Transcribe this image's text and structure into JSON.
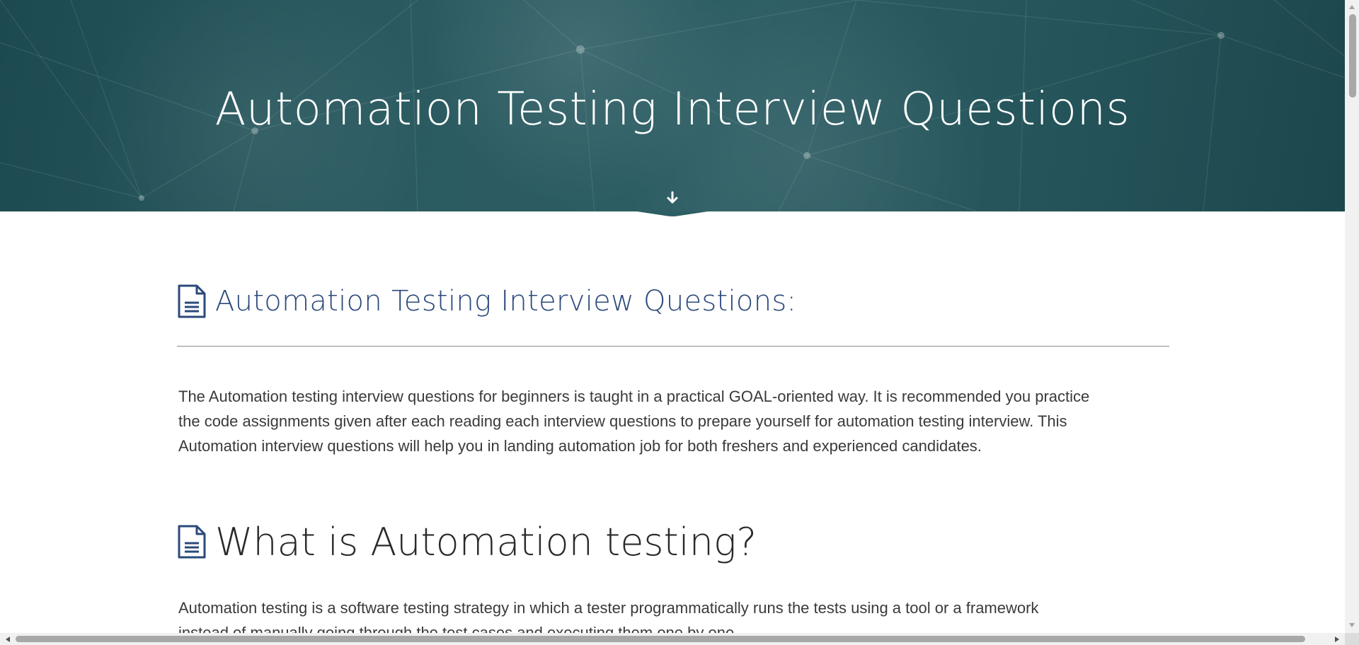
{
  "hero": {
    "title": "Automation Testing Interview Questions"
  },
  "section_intro": {
    "heading": "Automation Testing Interview Questions:",
    "paragraph_lines": [
      "The Automation testing interview questions for beginners is taught in a practical GOAL-oriented way. It is recommended you practice",
      "the code assignments given after each  reading each interview questions to prepare yourself for automation testing interview. This",
      "Automation interview questions will help you in landing automation job for both freshers and experienced candidates."
    ]
  },
  "section_what": {
    "heading": "What is Automation testing?",
    "paragraph_lines": [
      "Automation testing is a software testing strategy in which a tester programmatically runs the tests using a tool or a framework",
      "instead of manually going through the test cases and executing them one by one."
    ]
  },
  "icons": {
    "heading_icon": "document-icon",
    "scroll_icon": "arrow-down-icon"
  },
  "colors": {
    "hero_bg": "#2b5b61",
    "heading_blue": "#2b4a7a",
    "text": "#3a3a3a"
  }
}
